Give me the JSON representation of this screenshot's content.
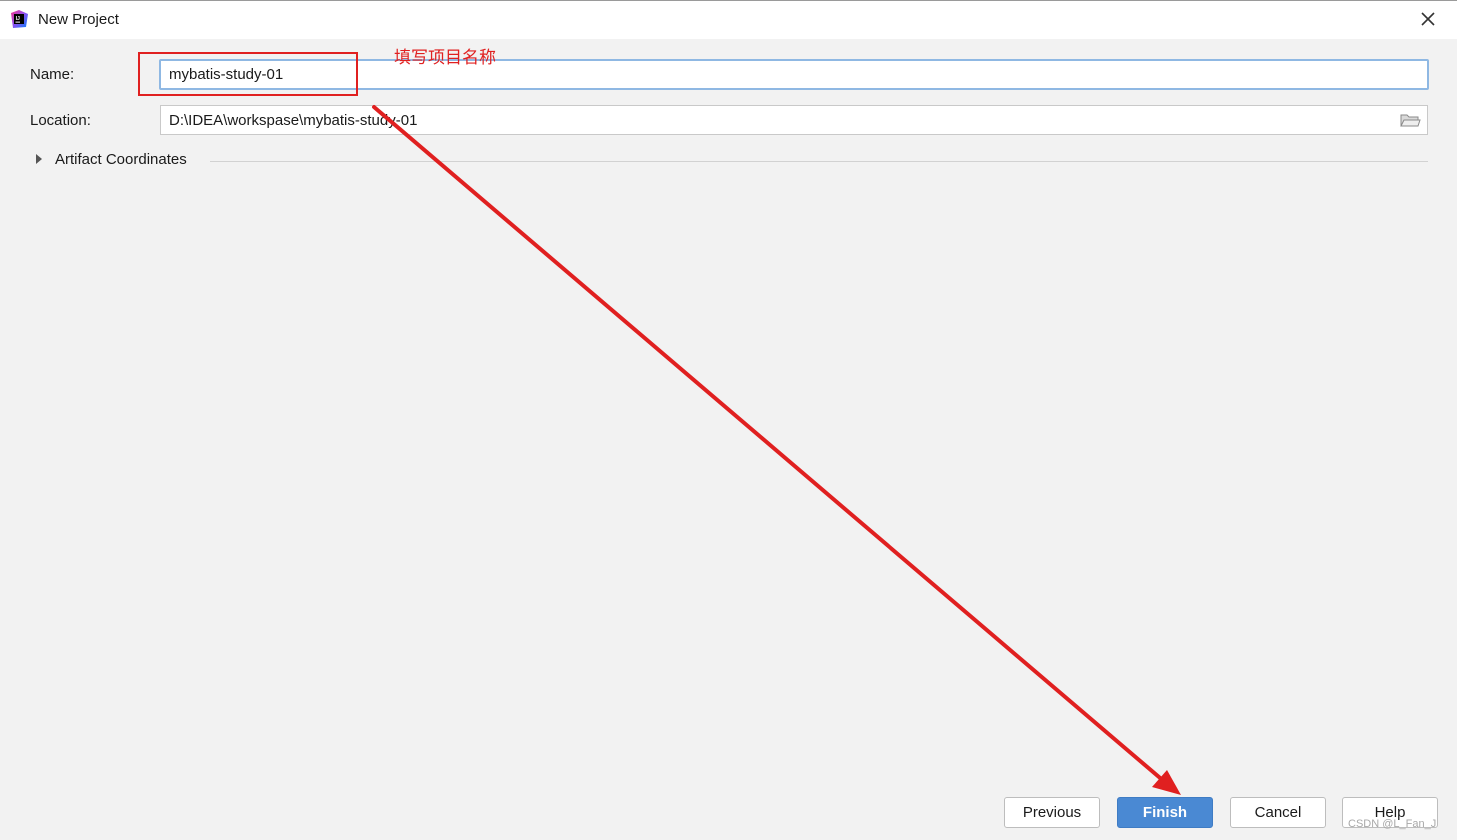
{
  "window": {
    "title": "New Project",
    "app_icon": "intellij-idea-icon",
    "close_icon": "close-icon"
  },
  "form": {
    "name_label": "Name:",
    "name_value": "mybatis-study-01",
    "location_label": "Location:",
    "location_value": "D:\\IDEA\\workspase\\mybatis-study-01",
    "folder_icon": "folder-icon",
    "artifact_section_label": "Artifact Coordinates",
    "artifact_expanded": false
  },
  "footer": {
    "previous_label": "Previous",
    "finish_label": "Finish",
    "cancel_label": "Cancel",
    "help_label": "Help"
  },
  "annotation": {
    "note_text": "填写项目名称",
    "color": "#e02020"
  },
  "watermark": {
    "text": "CSDN @L_Fan_J"
  },
  "colors": {
    "primary_button": "#4a89d3",
    "focus_border": "#8fb8e3",
    "background": "#f2f2f2"
  }
}
